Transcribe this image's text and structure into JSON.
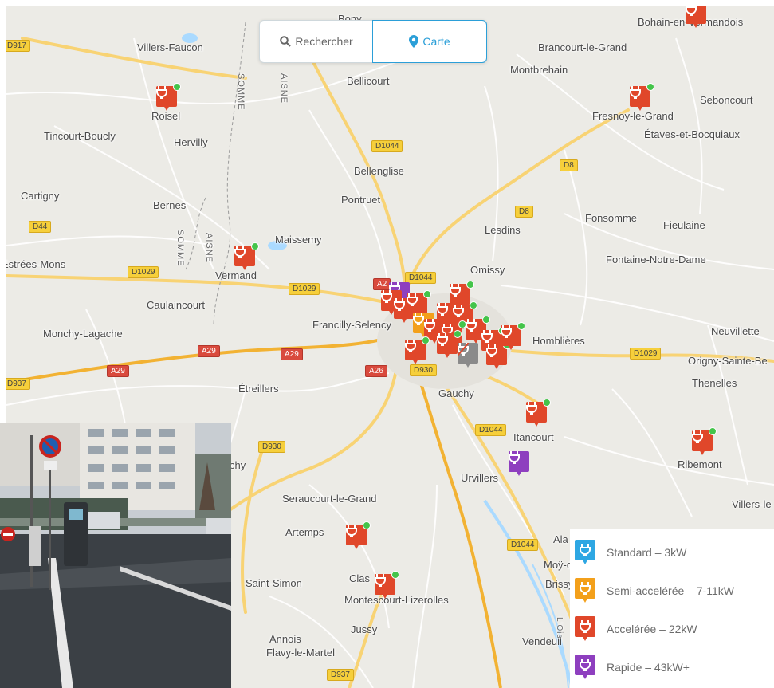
{
  "search": {
    "search_label": "Rechercher",
    "search_icon": "search-icon",
    "map_label": "Carte",
    "map_icon": "map-pin-icon"
  },
  "places": {
    "bony": "Bony",
    "bohain": "Bohain-en-Vermandois",
    "villers_faucon": "Villers-Faucon",
    "brancourt": "Brancourt-le-Grand",
    "montbrehain": "Montbrehain",
    "bellicourt": "Bellicourt",
    "roisel": "Roisel",
    "seboncourt": "Seboncourt",
    "fresnoy": "Fresnoy-le-Grand",
    "etaves": "Étaves-et-Bocquiaux",
    "tincourt": "Tincourt-Boucly",
    "hervilly": "Hervilly",
    "bellenglise": "Bellenglise",
    "cartigny": "Cartigny",
    "bernes": "Bernes",
    "pontruet": "Pontruet",
    "fonsomme": "Fonsomme",
    "fieulaine": "Fieulaine",
    "lesdins": "Lesdins",
    "maissemy": "Maissemy",
    "estrees": "Estrées-Mons",
    "fontaine": "Fontaine-Notre-Dame",
    "vermand": "Vermand",
    "omissy": "Omissy",
    "caulaincourt": "Caulaincourt",
    "francilly": "Francilly-Selency",
    "monchy": "Monchy-Lagache",
    "neuvillette": "Neuvillette",
    "hombliere": "Homblières",
    "origny": "Origny-Sainte-Be",
    "thenelles": "Thenelles",
    "etreillers": "Étreillers",
    "gauchy": "Gauchy",
    "itancourt": "Itancourt",
    "ribemont": "Ribemont",
    "urvillers": "Urvillers",
    "seraucourt": "Seraucourt-le-Grand",
    "villers_le": "Villers-le",
    "artemps": "Artemps",
    "ala": "Ala",
    "moy": "Moÿ-de-l",
    "saint_simon": "Saint-Simon",
    "clas": "Clas",
    "brissy": "Brissy-",
    "montescourt": "Montescourt-Lizerolles",
    "jussy": "Jussy",
    "annois": "Annois",
    "flavy": "Flavy-le-Martel",
    "vendeuil": "Vendeuil",
    "chy": "chy",
    "somme1": "SOMME",
    "aisne1": "AISNE",
    "somme2": "SOMME",
    "aisne2": "AISNE",
    "oise": "L'Ois"
  },
  "roads": {
    "d917": "D917",
    "d1044a": "D1044",
    "d8a": "D8",
    "d8b": "D8",
    "d44": "D44",
    "d1029a": "D1029",
    "d1029b": "D1029",
    "d1044b": "D1044",
    "a29a": "A29",
    "a29b": "A29",
    "a29c": "A29",
    "d937a": "D937",
    "a26": "A26",
    "d930a": "D930",
    "d1029c": "D1029",
    "d1044c": "D1044",
    "d930b": "D930",
    "d1044d": "D1044",
    "d937b": "D937",
    "a2x": "A2"
  },
  "legend": [
    {
      "label": "Standard – 3kW",
      "color": "#2ea7e3"
    },
    {
      "label": "Semi-accelérée – 7-11kW",
      "color": "#f3a01b"
    },
    {
      "label": "Accelérée – 22kW",
      "color": "#e0472a"
    },
    {
      "label": "Rapide – 43kW+",
      "color": "#8e3fbf"
    }
  ],
  "colors": {
    "accelere": "#e0472a",
    "rapide": "#8e3fbf",
    "semi": "#f3a01b",
    "standard": "#2ea7e3",
    "available": "#44c44a",
    "accent": "#2b9fd8"
  },
  "icons": {
    "marker": "charging-station-icon",
    "available": "available-dot-icon"
  }
}
